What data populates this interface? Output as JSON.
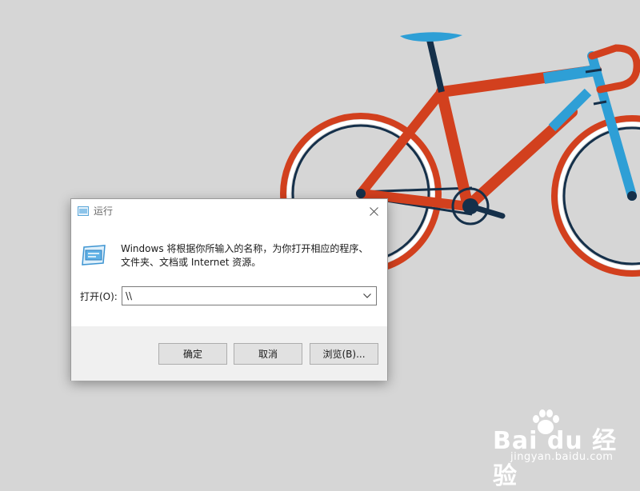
{
  "dialog": {
    "title": "运行",
    "description": "Windows 将根据你所输入的名称，为你打开相应的程序、文件夹、文档或 Internet 资源。",
    "open_label": "打开(O):",
    "open_value": "\\\\",
    "icons": {
      "title": "run-icon",
      "close": "close-icon",
      "dropdown": "chevron-down-icon"
    },
    "buttons": {
      "ok": "确定",
      "cancel": "取消",
      "browse": "浏览(B)..."
    }
  },
  "watermark": {
    "logo": "Bai du 经验",
    "url": "jingyan.baidu.com"
  },
  "colors": {
    "frame_red": "#d2401e",
    "frame_blue": "#2e9fd6",
    "navy": "#15304a",
    "background": "#d6d6d6"
  }
}
